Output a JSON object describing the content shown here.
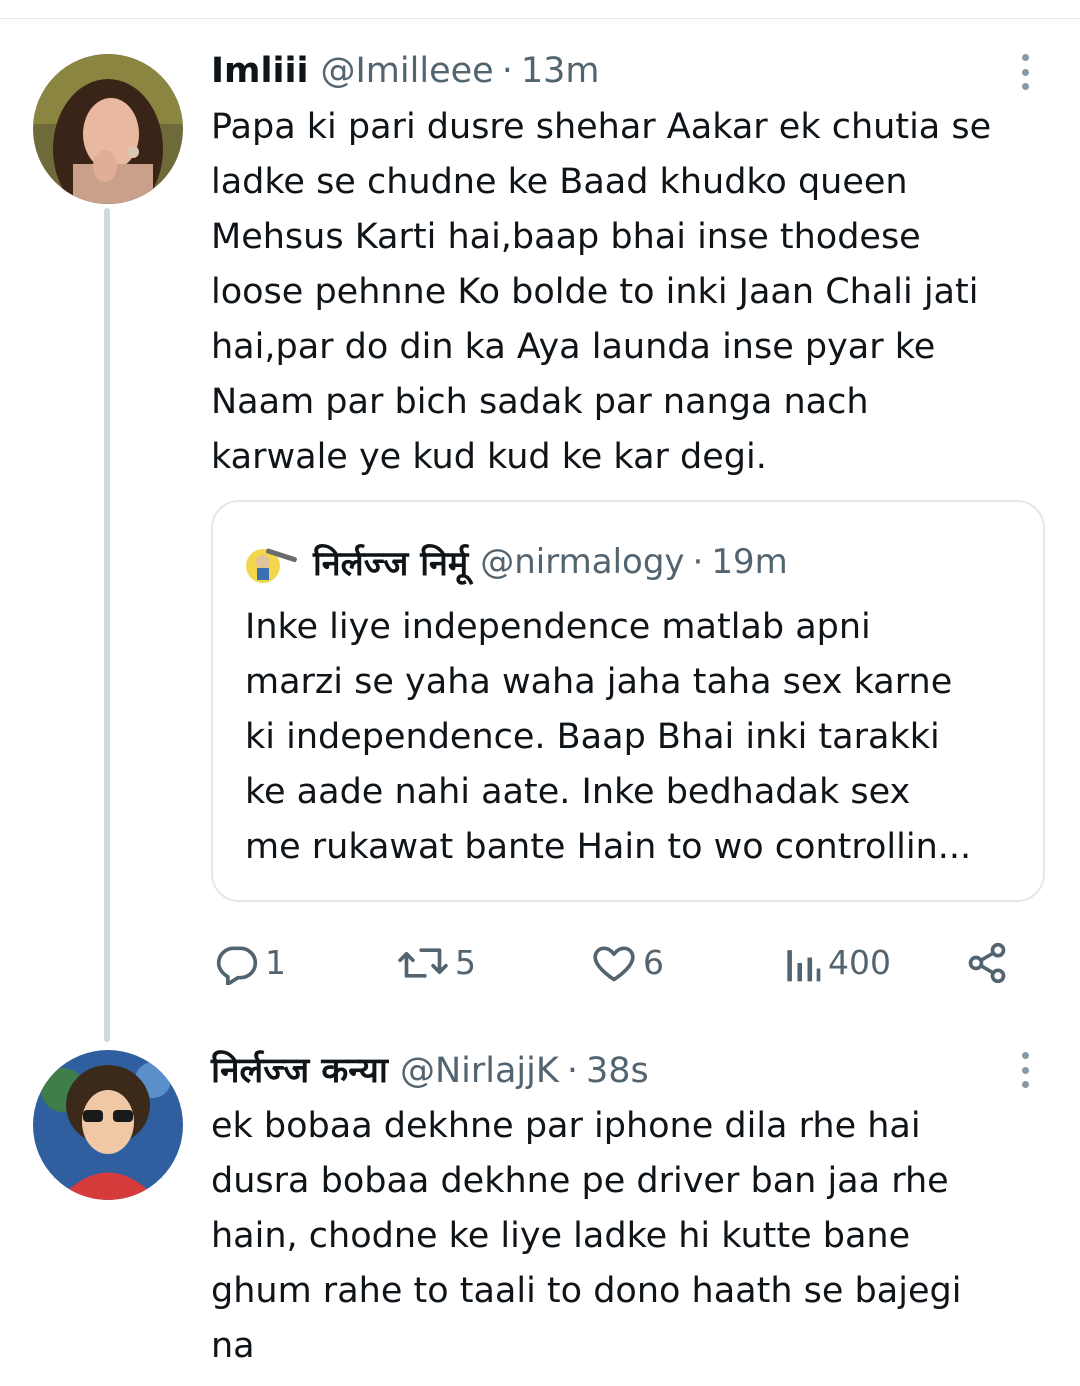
{
  "tweets": [
    {
      "name": "Imliii",
      "handle": "@Imilleee",
      "separator": "·",
      "time": "13m",
      "text": "Papa ki pari dusre shehar Aakar ek chutia se\nladke se chudne ke Baad khudko queen\nMehsus Karti hai,baap bhai inse thodese\nloose pehnne Ko bolde to inki Jaan Chali jati\nhai,par do din ka Aya launda inse pyar ke\nNaam par bich sadak par nanga nach\nkarwale ye kud kud ke kar degi.",
      "quote": {
        "name": "निर्लज्ज निर्मू",
        "handle": "@nirmalogy",
        "separator": "·",
        "time": "19m",
        "text": "Inke liye independence matlab apni\nmarzi se yaha waha jaha taha sex karne\nki independence. Baap Bhai inki tarakki\nke aade nahi aate. Inke bedhadak sex\nme rukawat bante Hain to wo controllin..."
      },
      "actions": {
        "replies": "1",
        "retweets": "5",
        "likes": "6",
        "views": "400"
      }
    },
    {
      "name": "निर्लज्ज कन्या",
      "handle": "@NirlajjK",
      "separator": "·",
      "time": "38s",
      "text": "ek bobaa dekhne par iphone dila rhe hai\ndusra bobaa dekhne pe driver ban jaa rhe\nhain, chodne ke liye ladke hi kutte bane\nghum rahe to taali to dono haath se bajegi\nna"
    }
  ],
  "icons": {
    "reply": "reply-icon",
    "retweet": "retweet-icon",
    "like": "heart-icon",
    "views": "views-icon",
    "share": "share-icon",
    "more": "more-options-icon"
  },
  "colors": {
    "text": "#0f1419",
    "secondary": "#536471",
    "border": "#e1e8ed",
    "thread_line": "#cfd9de"
  }
}
